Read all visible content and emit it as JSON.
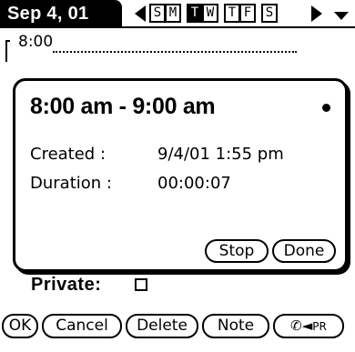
{
  "header": {
    "date_label": "Sep 4, 01",
    "days": [
      "S",
      "M",
      "T",
      "W",
      "T",
      "F",
      "S"
    ],
    "selected_day_index": 2,
    "prev_icon": "left-arrow-icon",
    "next_icon": "right-arrow-icon",
    "menu_icon": "dropdown-triangle-icon"
  },
  "background": {
    "first_time": "8:00"
  },
  "popup": {
    "time_range": "8:00 am - 9:00 am",
    "created_label": "Created :",
    "created_value": "9/4/01 1:55 pm",
    "duration_label": "Duration :",
    "duration_value": "00:00:07",
    "stop_label": "Stop",
    "done_label": "Done"
  },
  "private": {
    "label": "Private:",
    "checked": false
  },
  "buttons": {
    "ok": "OK",
    "cancel": "Cancel",
    "delete": "Delete",
    "note": "Note",
    "pr": "PR"
  }
}
